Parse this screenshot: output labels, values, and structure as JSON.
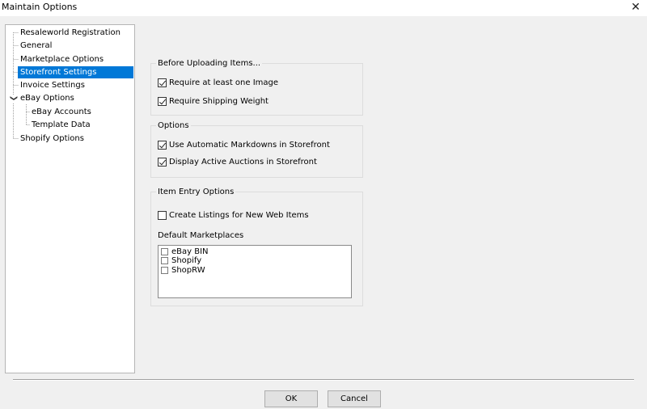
{
  "window": {
    "title": "Maintain Options",
    "close_glyph": "✕"
  },
  "tree": {
    "items": [
      {
        "label": "Resaleworld Registration"
      },
      {
        "label": "General"
      },
      {
        "label": "Marketplace Options"
      },
      {
        "label": "Storefront Settings",
        "selected": true
      },
      {
        "label": "Invoice Settings"
      },
      {
        "label": "eBay Options",
        "expanded": true
      },
      {
        "label": "eBay Accounts"
      },
      {
        "label": "Template Data"
      },
      {
        "label": "Shopify Options"
      }
    ],
    "expander_glyph": "❯"
  },
  "groups": {
    "before_upload": {
      "title": "Before Uploading Items...",
      "options": [
        {
          "label": "Require at least one Image",
          "checked": true
        },
        {
          "label": "Require Shipping Weight",
          "checked": true
        }
      ]
    },
    "options": {
      "title": "Options",
      "options": [
        {
          "label": "Use Automatic Markdowns in Storefront",
          "checked": true
        },
        {
          "label": "Display Active Auctions in Storefront",
          "checked": true
        }
      ]
    },
    "item_entry": {
      "title": "Item Entry Options",
      "create_listings": {
        "label": "Create Listings for New Web Items",
        "checked": false
      },
      "default_marketplaces_label": "Default Marketplaces",
      "marketplaces": [
        {
          "label": "eBay BIN",
          "checked": false
        },
        {
          "label": "Shopify",
          "checked": false
        },
        {
          "label": "ShopRW",
          "checked": false
        }
      ]
    }
  },
  "buttons": {
    "ok": "OK",
    "cancel": "Cancel"
  },
  "colors": {
    "selection": "#0078d7",
    "window_bg": "#f0f0f0"
  }
}
